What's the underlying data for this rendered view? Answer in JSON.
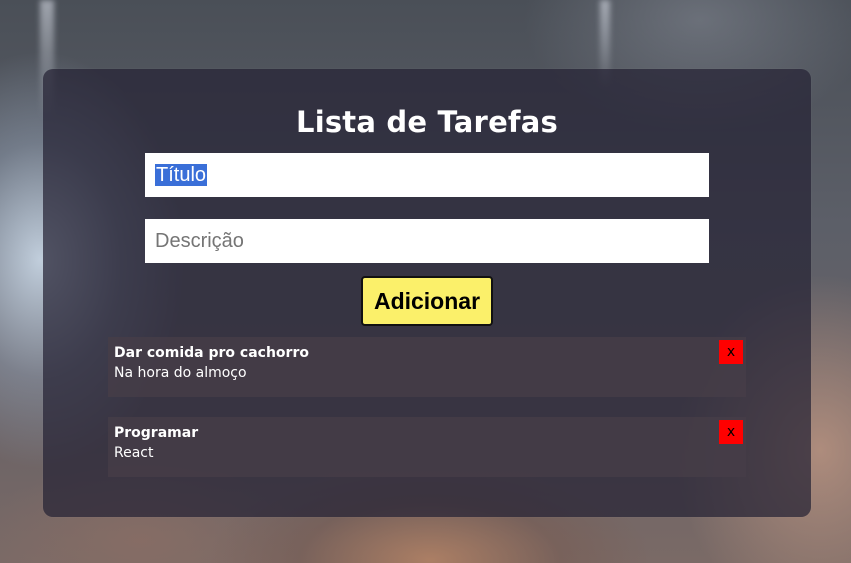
{
  "app": {
    "title": "Lista de Tarefas"
  },
  "form": {
    "title_input": {
      "value": "Título",
      "placeholder": "Título",
      "selected": true
    },
    "description_input": {
      "value": "",
      "placeholder": "Descrição"
    },
    "add_button_label": "Adicionar"
  },
  "tasks": [
    {
      "title": "Dar comida pro cachorro",
      "description": "Na hora do almoço",
      "delete_label": "x"
    },
    {
      "title": "Programar",
      "description": "React",
      "delete_label": "x"
    }
  ],
  "colors": {
    "card_background": "#26223499",
    "add_button": "#fbf06a",
    "delete_button": "#ff0000",
    "selection": "#3a6fd8"
  },
  "icons": {
    "delete": "close-icon"
  }
}
